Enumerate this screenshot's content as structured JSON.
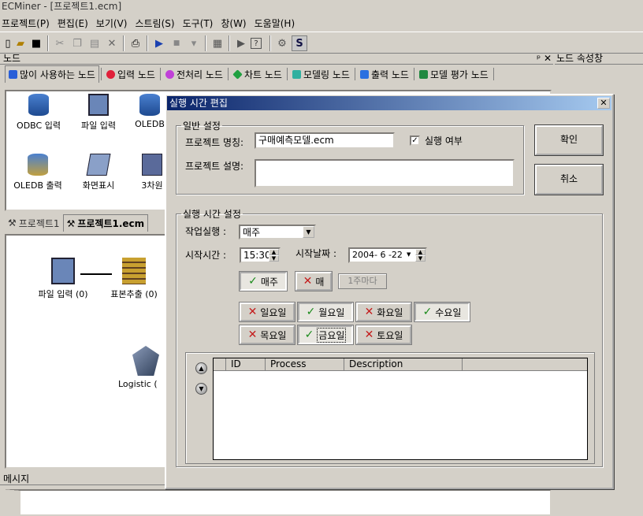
{
  "app": {
    "title": "ECMiner - [프로젝트1.ecm]"
  },
  "menu": [
    "프로젝트(P)",
    "편집(E)",
    "보기(V)",
    "스트림(S)",
    "도구(T)",
    "창(W)",
    "도움말(H)"
  ],
  "toolbar": {
    "s_label": "S"
  },
  "nodes_panel": {
    "title": "노드",
    "tabs": [
      {
        "label": "많이 사용하는 노드",
        "color": "#2a5fd8"
      },
      {
        "label": "입력 노드",
        "color": "#e0203a"
      },
      {
        "label": "전처리 노드",
        "color": "#c040d8"
      },
      {
        "label": "차트 노드",
        "color": "#20a040"
      },
      {
        "label": "모델링 노드",
        "color": "#30b0a0"
      },
      {
        "label": "출력 노드",
        "color": "#2a70e0"
      },
      {
        "label": "모델 평가 노드",
        "color": "#208840"
      }
    ],
    "items": [
      "ODBC 입력",
      "파일 입력",
      "OLEDB",
      "OLEDB 출력",
      "화면표시",
      "3차원"
    ]
  },
  "props_panel": {
    "title": "노드 속성창"
  },
  "project_tabs": [
    "프로젝트1",
    "프로젝트1.ecm"
  ],
  "canvas_nodes": [
    "파일 입력 (0)",
    "표본추출 (0)",
    "Logistic ("
  ],
  "messages": {
    "title": "메시지"
  },
  "dialog": {
    "title": "실행 시간 편집",
    "general": {
      "legend": "일반 설정",
      "name_label": "프로젝트 명칭:",
      "name_value": "구매예측모델.ecm",
      "run_label": "실행 여부",
      "desc_label": "프로젝트 설명:",
      "desc_value": ""
    },
    "ok": "확인",
    "cancel": "취소",
    "schedule": {
      "legend": "실행 시간 설정",
      "job_label": "작업실행 :",
      "job_value": "매주",
      "start_time_label": "시작시간 :",
      "start_time_value": "15:30",
      "start_date_label": "시작날짜 :",
      "start_date_value": "2004- 6 -22",
      "weekly": "매주",
      "every": "매",
      "every_n": "1주마다",
      "days": [
        {
          "label": "일요일",
          "on": false
        },
        {
          "label": "월요일",
          "on": true
        },
        {
          "label": "화요일",
          "on": false
        },
        {
          "label": "수요일",
          "on": true
        },
        {
          "label": "목요일",
          "on": false
        },
        {
          "label": "금요일",
          "on": true
        },
        {
          "label": "토요일",
          "on": false
        }
      ],
      "grid_headers": [
        "ID",
        "Process",
        "Description"
      ]
    }
  }
}
